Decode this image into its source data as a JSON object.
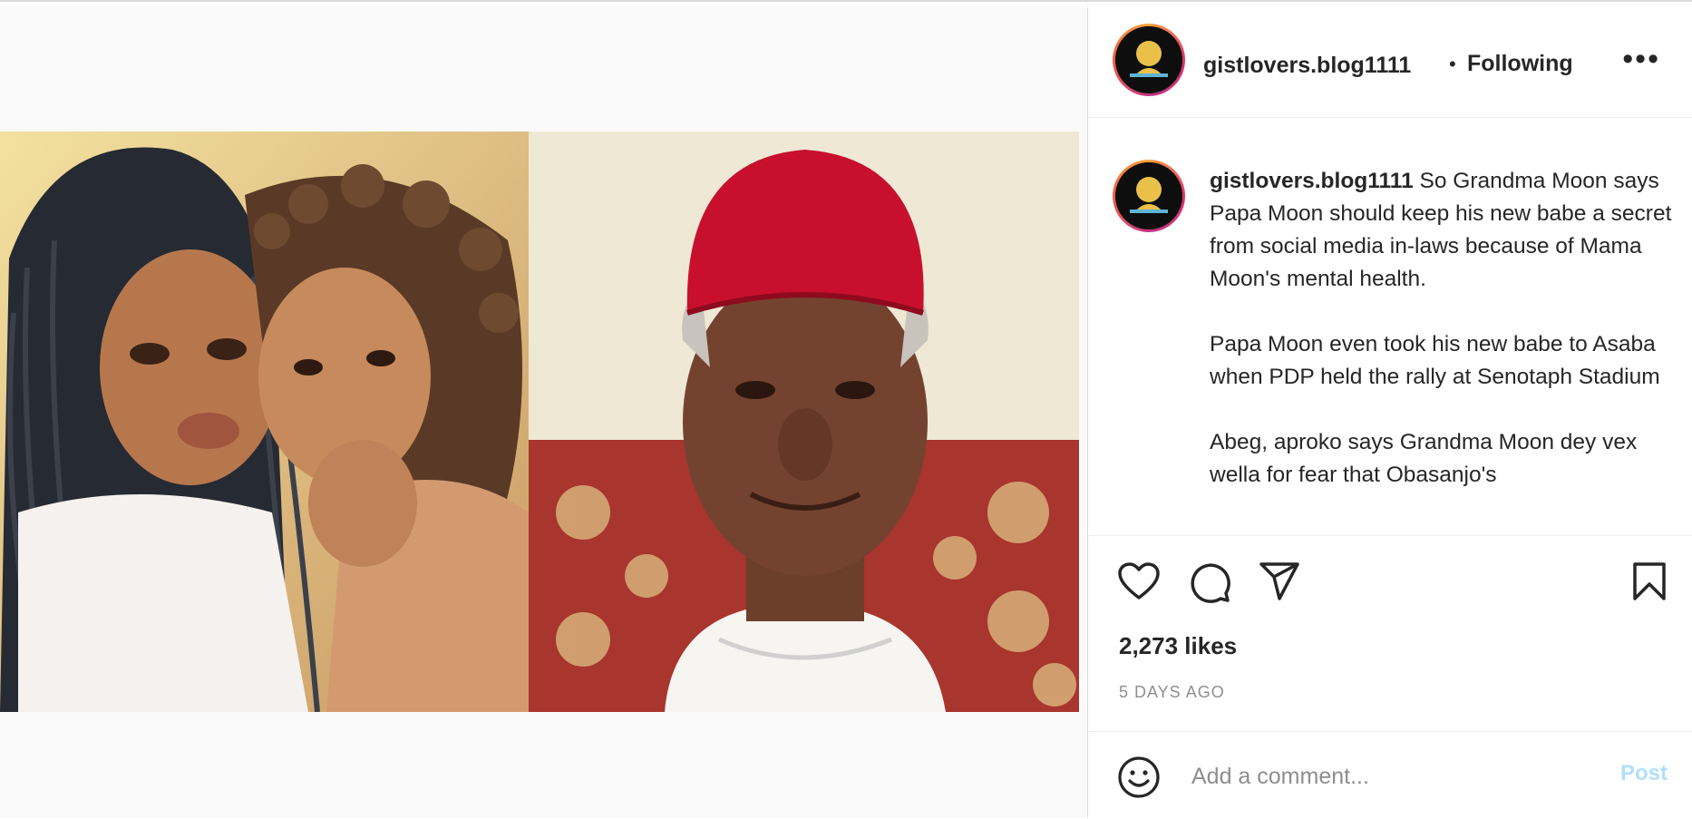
{
  "post": {
    "username": "gistlovers.blog1111",
    "separator": "•",
    "follow_status": "Following",
    "more_label": "•••",
    "caption_username": "gistlovers.blog1111",
    "caption_paragraphs": [
      "So Grandma Moon says Papa Moon should keep his new babe a secret from social media in-laws because of Mama Moon's mental health.",
      "Papa Moon even took his new babe to Asaba when PDP held the rally at Senotaph Stadium",
      "Abeg, aproko says Grandma Moon dey vex wella for fear that Obasanjo's"
    ],
    "likes": "2,273 likes",
    "timestamp": "5 DAYS AGO"
  },
  "comment": {
    "placeholder": "Add a comment...",
    "post_label": "Post"
  },
  "colors": {
    "accent_disabled": "#b2dffc",
    "text": "#262626",
    "muted": "#8e8e8e",
    "border": "#dbdbdb",
    "cap_red": "#c8102e"
  },
  "icons": [
    "avatar",
    "like-heart-icon",
    "comment-bubble-icon",
    "share-paper-plane-icon",
    "save-bookmark-icon",
    "emoji-smiley-icon",
    "more-options-icon"
  ]
}
